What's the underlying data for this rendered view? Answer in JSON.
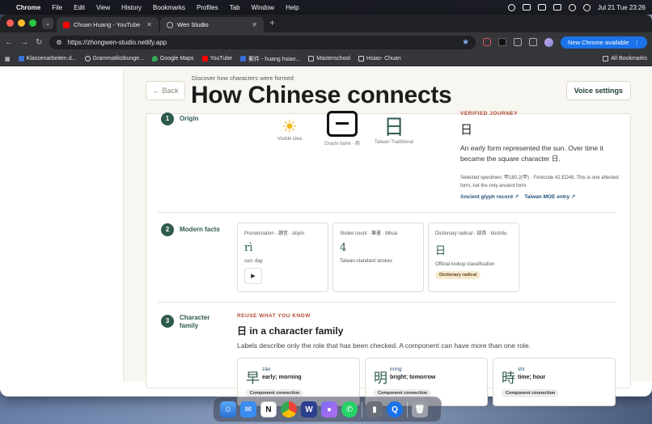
{
  "menubar": {
    "app": "Chrome",
    "items": [
      "File",
      "Edit",
      "View",
      "History",
      "Bookmarks",
      "Profiles",
      "Tab",
      "Window",
      "Help"
    ],
    "datetime": "Jul 21 Tue  23:26"
  },
  "browser": {
    "tabs": [
      {
        "title": "Chuan Huang - YouTube"
      },
      {
        "title": "Wen Studio"
      }
    ],
    "url": "https://zhongwen-studio.netlify.app",
    "new_chrome": "New Chrome available",
    "bookmarks": [
      {
        "label": "Klassenarbeiten.d..."
      },
      {
        "label": "Grammatikübunge..."
      },
      {
        "label": "Google Maps"
      },
      {
        "label": "YouTube"
      },
      {
        "label": "郵件 - huang hsiao..."
      },
      {
        "label": "Masterschool"
      },
      {
        "label": "Hsiao- Chuan"
      }
    ],
    "all_bookmarks": "All Bookmarks"
  },
  "page": {
    "back": "Back",
    "eyebrow": "Discover how characters were formed",
    "title": "How Chinese connects",
    "voice_settings": "Voice settings",
    "origin": {
      "step": "1",
      "title": "Origin",
      "glyphs": [
        {
          "label": "Visible idea"
        },
        {
          "label": "Oracle bone · 商"
        },
        {
          "char": "日",
          "label": "Taiwan Traditional"
        }
      ],
      "verified": "VERIFIED JOURNEY",
      "char": "日",
      "text": "An early form represented the sun. Over time it became the square character 日.",
      "specimen": "Selected specimen: 甲180.2(甲) · Fontcode 42.ED48. This is one attested form, not the only ancient form.",
      "links": [
        "Ancient glyph record ↗",
        "Taiwan MOE entry ↗"
      ]
    },
    "modern": {
      "step": "2",
      "title": "Modern facts",
      "cards": [
        {
          "label": "Pronunciation · 讀音 · dúyīn",
          "value": "rì",
          "sub": "sun; day",
          "play": "▶"
        },
        {
          "label": "Stroke count · 筆畫 · bǐhuà",
          "value": "4",
          "sub": "Taiwan-standard strokes"
        },
        {
          "label": "Dictionary radical · 部首 · bùshǒu",
          "value": "日",
          "sub": "Official lookup classification",
          "badge": "Dictionary radical"
        }
      ]
    },
    "family": {
      "step": "3",
      "title_line1": "Character",
      "title_line2": "family",
      "eyebrow": "REUSE WHAT YOU KNOW",
      "heading": "日 in a character family",
      "desc": "Labels describe only the role that has been checked. A component can have more than one role.",
      "cards": [
        {
          "char": "早",
          "pinyin": "zǎo",
          "meaning": "early; morning",
          "badge": "Component connection"
        },
        {
          "char": "明",
          "pinyin": "míng",
          "meaning": "bright; tomorrow",
          "badge": "Component connection"
        },
        {
          "char": "時",
          "pinyin": "shí",
          "meaning": "time; hour",
          "badge": "Component connection"
        }
      ]
    }
  },
  "colors": {
    "accent_green": "#2f5b4c",
    "accent_red": "#b14a32",
    "link_blue": "#1f4f7a"
  }
}
